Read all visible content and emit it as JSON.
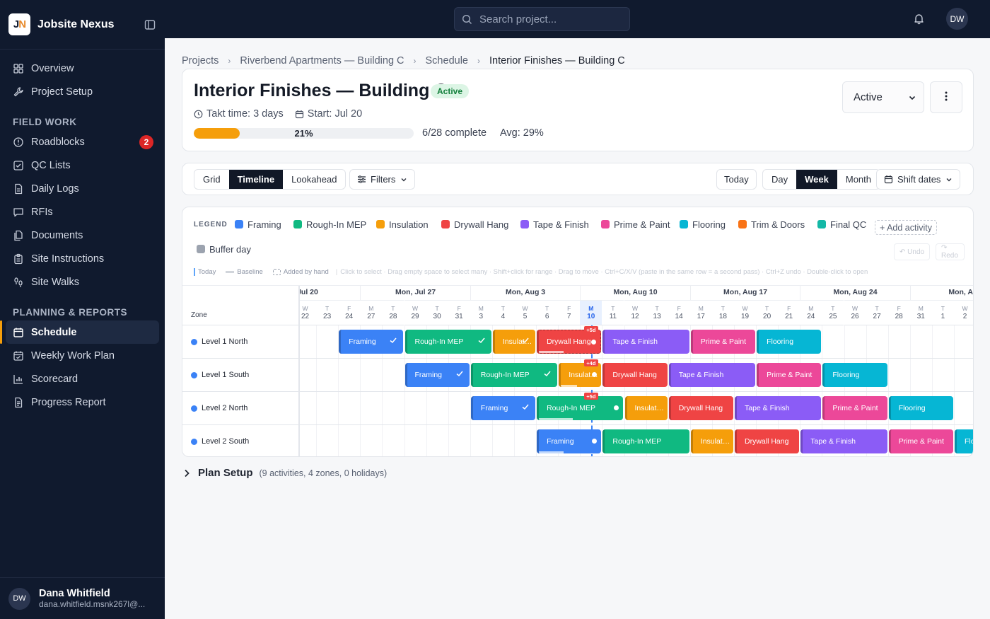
{
  "app": {
    "name": "Jobsite Nexus",
    "logo_text": "JN"
  },
  "sidebar": {
    "items_top": [
      {
        "label": "Overview",
        "icon": "grid-icon"
      },
      {
        "label": "Project Setup",
        "icon": "wrench-icon"
      }
    ],
    "section_field": "FIELD WORK",
    "items_field": [
      {
        "label": "Roadblocks",
        "icon": "alert-circle-icon",
        "badge": "2"
      },
      {
        "label": "QC Lists",
        "icon": "checkbox-icon"
      },
      {
        "label": "Daily Logs",
        "icon": "file-icon"
      },
      {
        "label": "RFIs",
        "icon": "message-icon"
      },
      {
        "label": "Documents",
        "icon": "files-icon"
      },
      {
        "label": "Site Instructions",
        "icon": "clipboard-icon"
      },
      {
        "label": "Site Walks",
        "icon": "footprints-icon"
      }
    ],
    "section_planning": "PLANNING & REPORTS",
    "items_planning": [
      {
        "label": "Schedule",
        "icon": "calendar-icon",
        "active": true
      },
      {
        "label": "Weekly Work Plan",
        "icon": "calendar-check-icon"
      },
      {
        "label": "Scorecard",
        "icon": "bar-chart-icon"
      },
      {
        "label": "Progress Report",
        "icon": "report-icon"
      }
    ],
    "user": {
      "initials": "DW",
      "name": "Dana Whitfield",
      "email": "dana.whitfield.msnk267l@..."
    }
  },
  "topbar": {
    "search_placeholder": "Search project...",
    "avatar": "DW"
  },
  "breadcrumb": [
    "Projects",
    "Riverbend Apartments — Building C",
    "Schedule",
    "Interior Finishes — Building C"
  ],
  "header": {
    "title": "Interior Finishes — Building C",
    "status": "Active",
    "takt": "Takt time: 3 days",
    "start": "Start: Jul 20",
    "progress_percent": 21,
    "progress_label": "21%",
    "complete": "6/28 complete",
    "avg": "Avg: 29%",
    "status_select": "Active"
  },
  "toolbar": {
    "views": [
      "Grid",
      "Timeline",
      "Lookahead"
    ],
    "active_view": "Timeline",
    "filters": "Filters",
    "today": "Today",
    "scales": [
      "Day",
      "Week",
      "Month"
    ],
    "active_scale": "Week",
    "shift": "Shift dates"
  },
  "legend": {
    "label": "LEGEND",
    "items": [
      {
        "name": "Framing",
        "color": "#3b82f6"
      },
      {
        "name": "Rough-In MEP",
        "color": "#10b981"
      },
      {
        "name": "Insulation",
        "color": "#f59e0b"
      },
      {
        "name": "Drywall Hang",
        "color": "#ef4444"
      },
      {
        "name": "Tape & Finish",
        "color": "#8b5cf6"
      },
      {
        "name": "Prime & Paint",
        "color": "#ec4899"
      },
      {
        "name": "Flooring",
        "color": "#06b6d4"
      },
      {
        "name": "Trim & Doors",
        "color": "#f97316"
      },
      {
        "name": "Final QC",
        "color": "#14b8a6"
      },
      {
        "name": "Buffer day",
        "color": "#9ca3af"
      }
    ],
    "add_activity": "+ Add activity",
    "undo": "↶ Undo",
    "redo": "↷ Redo"
  },
  "hint": {
    "today": "Today",
    "baseline": "Baseline",
    "added": "Added by hand",
    "help": "Click to select · Drag empty space to select many · Shift+click for range · Drag to move · Ctrl+C/X/V (paste in the same row = a second pass) · Ctrl+Z undo · Double-click to open"
  },
  "gantt": {
    "zone_header": "Zone",
    "weeks": [
      ", Jul 20",
      "Mon, Jul 27",
      "Mon, Aug 3",
      "Mon, Aug 10",
      "Mon, Aug 17",
      "Mon, Aug 24",
      "Mon, Aug"
    ],
    "days": [
      [
        "W",
        "22"
      ],
      [
        "T",
        "23"
      ],
      [
        "F",
        "24"
      ],
      [
        "M",
        "27"
      ],
      [
        "T",
        "28"
      ],
      [
        "W",
        "29"
      ],
      [
        "T",
        "30"
      ],
      [
        "F",
        "31"
      ],
      [
        "M",
        "3"
      ],
      [
        "T",
        "4"
      ],
      [
        "W",
        "5"
      ],
      [
        "T",
        "6"
      ],
      [
        "F",
        "7"
      ],
      [
        "M",
        "10"
      ],
      [
        "T",
        "11"
      ],
      [
        "W",
        "12"
      ],
      [
        "T",
        "13"
      ],
      [
        "F",
        "14"
      ],
      [
        "M",
        "17"
      ],
      [
        "T",
        "18"
      ],
      [
        "W",
        "19"
      ],
      [
        "T",
        "20"
      ],
      [
        "F",
        "21"
      ],
      [
        "M",
        "24"
      ],
      [
        "T",
        "25"
      ],
      [
        "W",
        "26"
      ],
      [
        "T",
        "27"
      ],
      [
        "F",
        "28"
      ],
      [
        "M",
        "31"
      ],
      [
        "T",
        "1"
      ],
      [
        "W",
        "2"
      ]
    ],
    "today_label": "M 10",
    "zones": [
      "Level 1 North",
      "Level 1 South",
      "Level 2 North",
      "Level 2 South"
    ],
    "rows": [
      [
        {
          "label": "Framing",
          "start_day": "Jul 24",
          "days": 3,
          "color": "#3b82f6",
          "done": true
        },
        {
          "label": "Rough-In MEP",
          "start_day": "Jul 29",
          "days": 4,
          "color": "#10b981",
          "done": true
        },
        {
          "label": "Insulation",
          "display": "Insulat…",
          "start_day": "Aug 4",
          "days": 2,
          "color": "#f59e0b",
          "done": true
        },
        {
          "label": "Drywall Hang",
          "start_day": "Aug 6",
          "days": 3,
          "color": "#ef4444",
          "dashed": true,
          "slip": "+5d",
          "active": true
        },
        {
          "label": "Tape & Finish",
          "start_day": "Aug 11",
          "days": 4,
          "color": "#8b5cf6"
        },
        {
          "label": "Prime & Paint",
          "start_day": "Aug 17",
          "days": 3,
          "color": "#ec4899"
        },
        {
          "label": "Flooring",
          "start_day": "Aug 20",
          "days": 3,
          "color": "#06b6d4"
        }
      ],
      [
        {
          "label": "Framing",
          "start_day": "Jul 29",
          "days": 3,
          "color": "#3b82f6",
          "done": true
        },
        {
          "label": "Rough-In MEP",
          "start_day": "Aug 3",
          "days": 4,
          "color": "#10b981",
          "done": true
        },
        {
          "label": "Insulation",
          "display": "Insulat…",
          "start_day": "Aug 7",
          "days": 2,
          "color": "#f59e0b",
          "slip": "+4d",
          "active": true
        },
        {
          "label": "Drywall Hang",
          "start_day": "Aug 11",
          "days": 3,
          "color": "#ef4444"
        },
        {
          "label": "Tape & Finish",
          "start_day": "Aug 14",
          "days": 4,
          "color": "#8b5cf6"
        },
        {
          "label": "Prime & Paint",
          "start_day": "Aug 20",
          "days": 3,
          "color": "#ec4899"
        },
        {
          "label": "Flooring",
          "start_day": "Aug 25",
          "days": 3,
          "color": "#06b6d4"
        }
      ],
      [
        {
          "label": "Framing",
          "start_day": "Aug 3",
          "days": 3,
          "color": "#3b82f6",
          "done": true
        },
        {
          "label": "Rough-In MEP",
          "start_day": "Aug 6",
          "days": 4,
          "color": "#10b981",
          "slip": "+5d",
          "active": true
        },
        {
          "label": "Insulation",
          "display": "Insulat…",
          "start_day": "Aug 12",
          "days": 2,
          "color": "#f59e0b"
        },
        {
          "label": "Drywall Hang",
          "start_day": "Aug 14",
          "days": 3,
          "color": "#ef4444"
        },
        {
          "label": "Tape & Finish",
          "start_day": "Aug 19",
          "days": 4,
          "color": "#8b5cf6"
        },
        {
          "label": "Prime & Paint",
          "start_day": "Aug 25",
          "days": 3,
          "color": "#ec4899"
        },
        {
          "label": "Flooring",
          "start_day": "Aug 28",
          "days": 3,
          "color": "#06b6d4"
        }
      ],
      [
        {
          "label": "Framing",
          "start_day": "Aug 6",
          "days": 3,
          "color": "#3b82f6",
          "active": true
        },
        {
          "label": "Rough-In MEP",
          "start_day": "Aug 11",
          "days": 4,
          "color": "#10b981"
        },
        {
          "label": "Insulation",
          "display": "Insulat…",
          "start_day": "Aug 17",
          "days": 2,
          "color": "#f59e0b"
        },
        {
          "label": "Drywall Hang",
          "start_day": "Aug 19",
          "days": 3,
          "color": "#ef4444"
        },
        {
          "label": "Tape & Finish",
          "start_day": "Aug 24",
          "days": 4,
          "color": "#8b5cf6"
        },
        {
          "label": "Prime & Paint",
          "start_day": "Aug 28",
          "days": 3,
          "color": "#ec4899"
        },
        {
          "label": "Flooring",
          "display": "Floo",
          "start_day": "Sep 2",
          "days": 3,
          "color": "#06b6d4"
        }
      ]
    ]
  },
  "plan_setup": {
    "title": "Plan Setup",
    "sub": "(9 activities, 4 zones, 0 holidays)"
  }
}
